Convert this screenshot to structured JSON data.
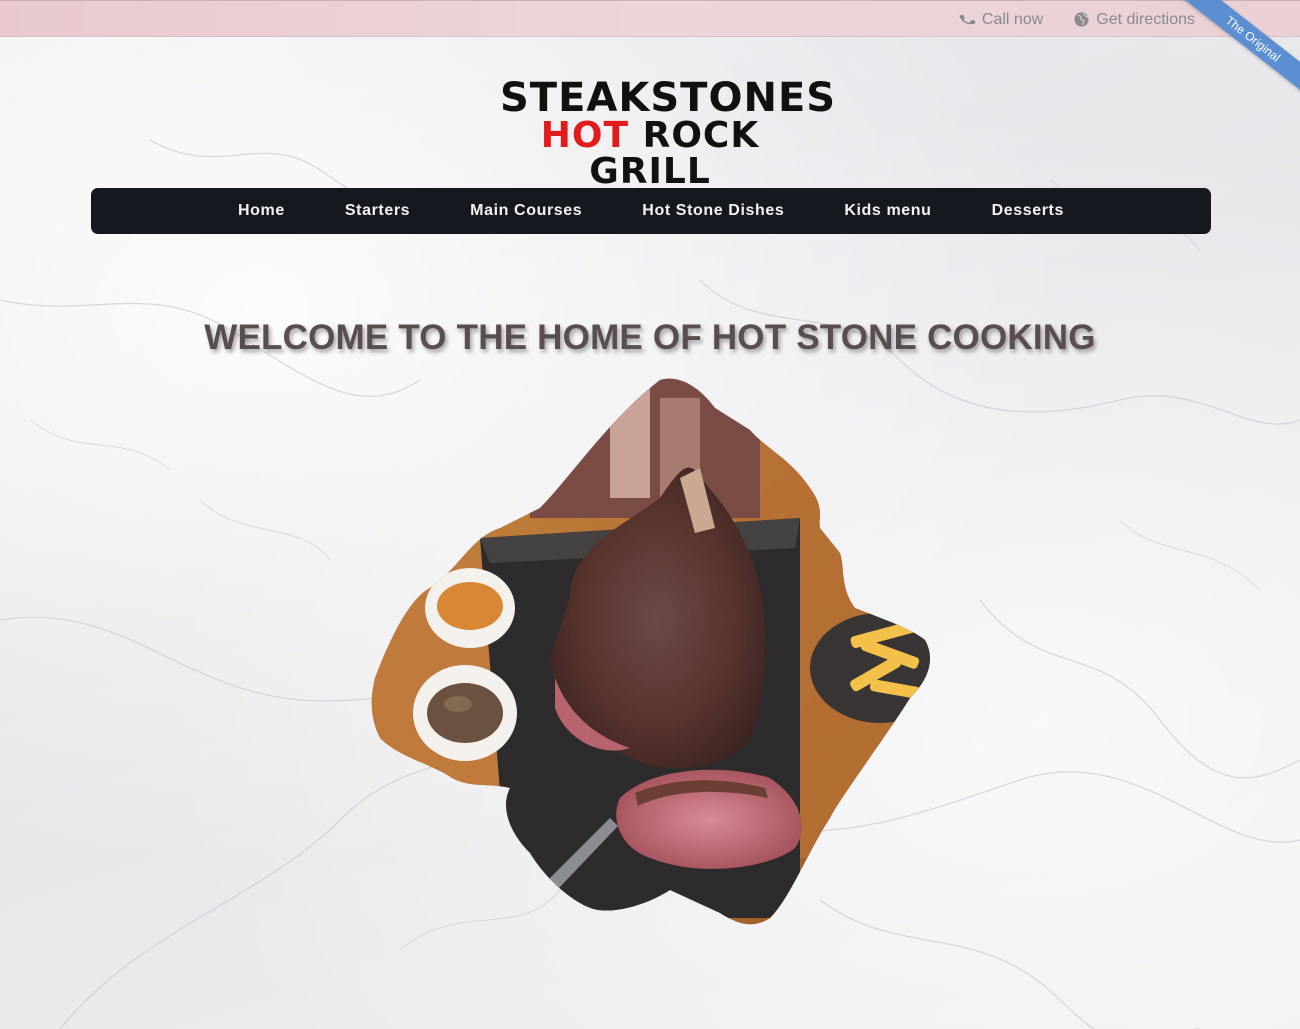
{
  "topbar": {
    "call_label": "Call now",
    "directions_label": "Get directions",
    "icons": {
      "call": "phone-icon",
      "directions": "globe-icon"
    }
  },
  "ribbon": {
    "label": "The Original",
    "color": "#5b8fd1"
  },
  "logo": {
    "line1": "STEAKSTONES",
    "line2_accent": "HOT",
    "line2_rest": "ROCK GRILL",
    "accent_color": "#e21c1c"
  },
  "nav": {
    "items": [
      "Home",
      "Starters",
      "Main Courses",
      "Hot Stone Dishes",
      "Kids menu",
      "Desserts"
    ],
    "background": "#15191f"
  },
  "main": {
    "headline": "WELCOME TO THE HOME OF HOT STONE COOKING",
    "hero_alt": "steak-on-hot-stone-photo"
  }
}
